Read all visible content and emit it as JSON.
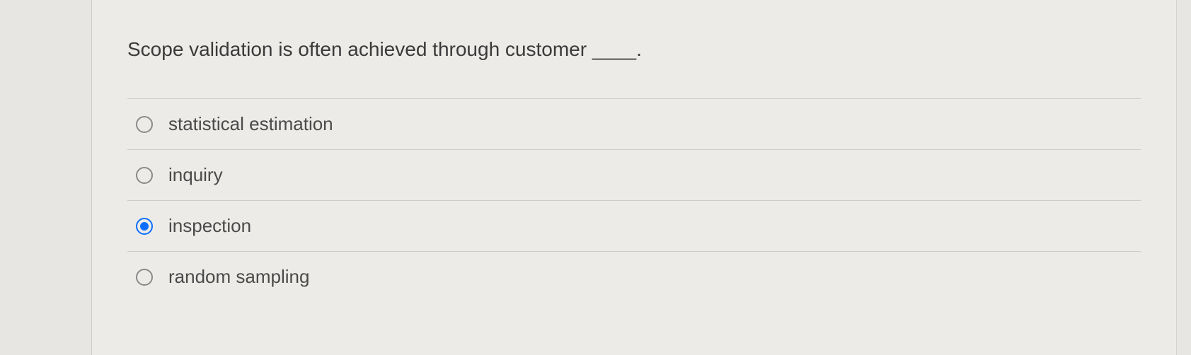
{
  "question": {
    "text": "Scope validation is often achieved through customer ____."
  },
  "options": [
    {
      "label": "statistical estimation",
      "selected": false
    },
    {
      "label": "inquiry",
      "selected": false
    },
    {
      "label": "inspection",
      "selected": true
    },
    {
      "label": "random sampling",
      "selected": false
    }
  ]
}
